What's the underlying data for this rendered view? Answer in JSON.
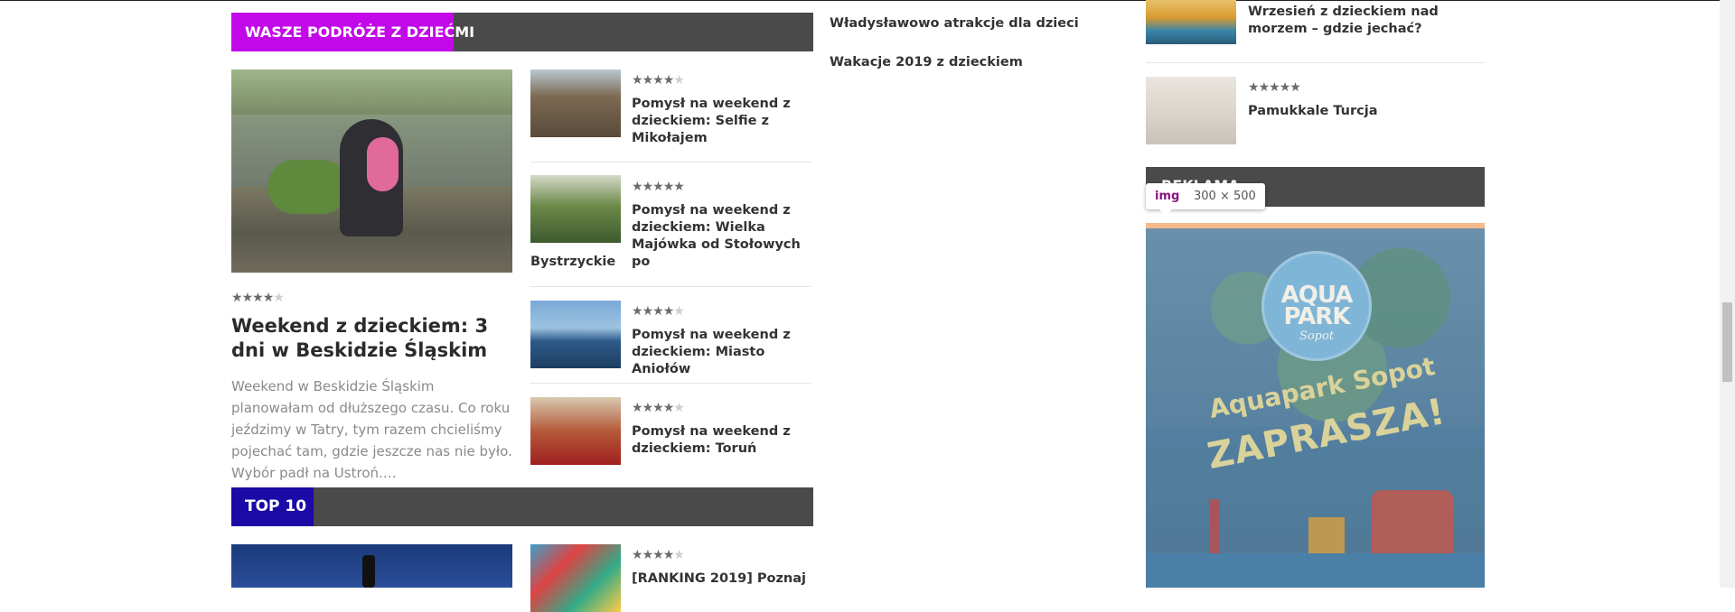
{
  "sections": {
    "family_trips": {
      "title": "WASZE PODRÓŻE Z DZIEĆMI"
    },
    "top10": {
      "title": "TOP 10"
    }
  },
  "featured": {
    "rating": 4,
    "title": "Weekend z dzieckiem: 3 dni w Beskidzie Śląskim",
    "excerpt": "Weekend w Beskidzie Śląskim planowałam od dłuższego czasu. Co roku jeździmy w Tatry, tym razem chcieliśmy pojechać tam, gdzie jeszcze nas nie było. Wybór padł na Ustroń.…"
  },
  "posts": [
    {
      "title": "Pomysł na weekend z dzieckiem: Selfie z Mikołajem",
      "rating": 4
    },
    {
      "title": "Pomysł na weekend z dzieckiem: Wielka Majówka od Stołowych po",
      "title_overflow": "Bystrzyckie",
      "rating": 5
    },
    {
      "title": "Pomysł na weekend z dzieckiem: Miasto Aniołów",
      "rating": 4.5
    },
    {
      "title": "Pomysł na weekend z dzieckiem: Toruń",
      "rating": 4.5
    }
  ],
  "top10_post": {
    "title": "[RANKING 2019] Poznaj",
    "rating": 4
  },
  "middle_links": [
    "Władysławowo atrakcje dla dzieci",
    "Wakacje 2019 z dzieckiem"
  ],
  "sidebar": {
    "posts": [
      {
        "title": "Wrzesień z dzieckiem nad morzem – gdzie jechać?"
      },
      {
        "title": "Pamukkale Turcja",
        "rating": 5
      }
    ],
    "widget_title": "REKLAMA",
    "ad": {
      "logo_main": "AQUA PARK",
      "logo_sub": "Sopot",
      "slogan_line1": "Aquapark Sopot",
      "slogan_line2": "ZAPRASZA!"
    }
  },
  "devtools_tooltip": {
    "tag": "img",
    "dimensions": "300 × 500"
  },
  "colors": {
    "family_header_accent": "#c208e8",
    "top10_header_accent": "#1b0aa6",
    "header_bar": "#4a4a4a",
    "star": "#6b6b6b",
    "star_empty": "#cfcfcf"
  }
}
